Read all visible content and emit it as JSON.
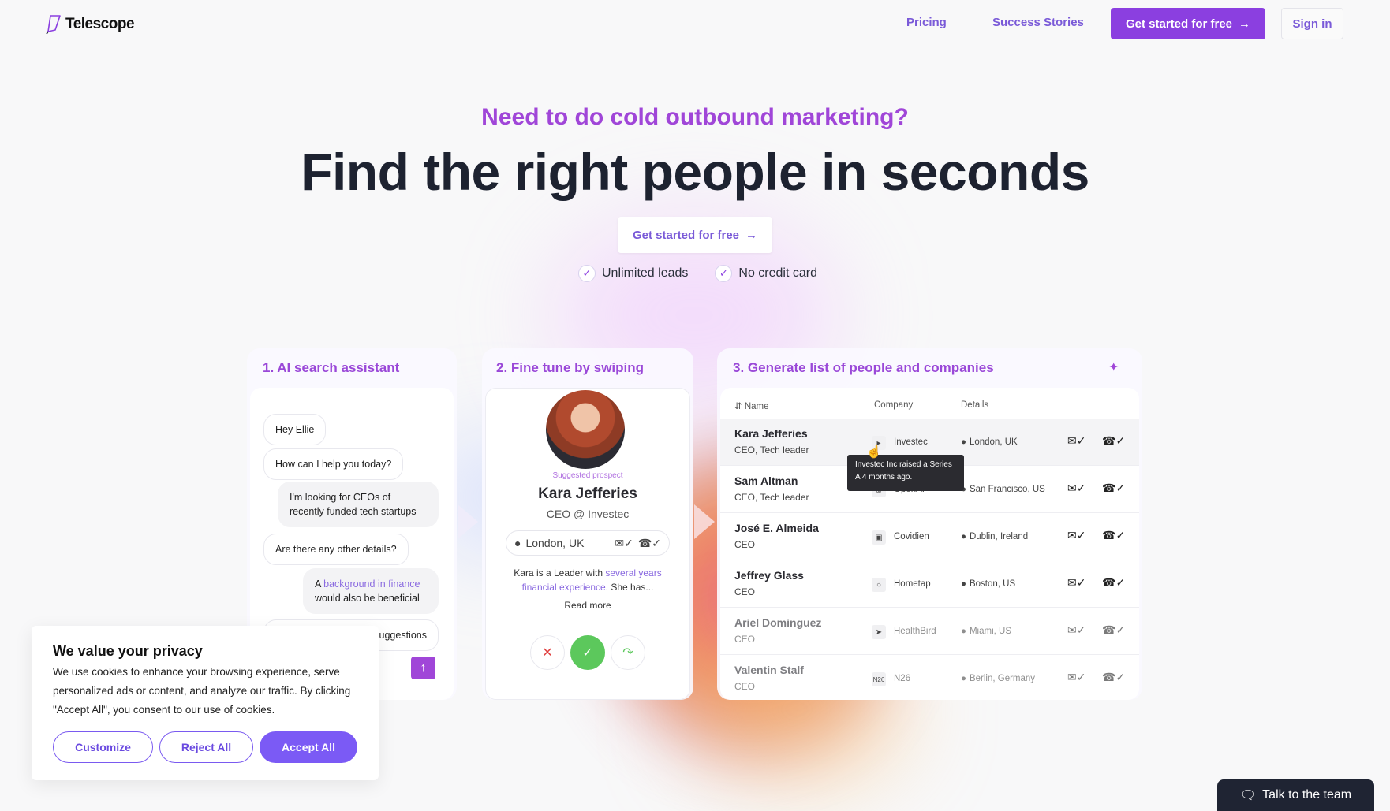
{
  "nav": {
    "logo": "Telescope",
    "links": [
      "Pricing",
      "Success Stories"
    ],
    "cta": "Get started for free",
    "signin": "Sign in"
  },
  "hero": {
    "eyebrow": "Need to do cold outbound marketing?",
    "headline": "Find the right people in seconds",
    "cta": "Get started for free",
    "checks": [
      "Unlimited leads",
      "No credit card"
    ]
  },
  "panels": {
    "assistant": {
      "title": "1. AI search assistant",
      "messages": [
        {
          "from": "bot",
          "text": "Hey Ellie"
        },
        {
          "from": "bot",
          "text": "How can I help you today?"
        },
        {
          "from": "user",
          "text": "I'm looking for CEOs of recently funded tech startups"
        },
        {
          "from": "bot",
          "text": "Are there any other details?"
        },
        {
          "from": "user",
          "pre": "A ",
          "highlight": "background in finance",
          "post": " would also be beneficial"
        },
        {
          "from": "bot",
          "text": "suggestions"
        }
      ]
    },
    "swipe": {
      "title": "2. Fine tune by swiping",
      "suggested": "Suggested prospect",
      "name": "Kara Jefferies",
      "role": "CEO @ Investec",
      "location": "London, UK",
      "desc_pre": "Kara is a Leader with ",
      "desc_hl": "several years financial experience",
      "desc_post": ". She has...",
      "read_more": "Read more"
    },
    "list": {
      "title": "3. Generate list of people and companies",
      "headers": [
        "Name",
        "Company",
        "Details"
      ],
      "tooltip": "Investec Inc raised a Series A 4 months ago.",
      "rows": [
        {
          "name": "Kara Jefferies",
          "title": "CEO, Tech leader",
          "company": "Investec",
          "icon": "investec-logo-icon",
          "location": "London, UK"
        },
        {
          "name": "Sam Altman",
          "title": "CEO, Tech leader",
          "company": "OpenAI",
          "icon": "openai-logo-icon",
          "location": "San Francisco, US"
        },
        {
          "name": "José E. Almeida",
          "title": "CEO",
          "company": "Covidien",
          "icon": "covidien-logo-icon",
          "location": "Dublin, Ireland"
        },
        {
          "name": "Jeffrey Glass",
          "title": "CEO",
          "company": "Hometap",
          "icon": "hometap-logo-icon",
          "location": "Boston, US"
        },
        {
          "name": "Ariel Dominguez",
          "title": "CEO",
          "company": "HealthBird",
          "icon": "healthbird-logo-icon",
          "location": "Miami, US"
        },
        {
          "name": "Valentin Stalf",
          "title": "CEO",
          "company": "N26",
          "icon": "n26-logo-icon",
          "location": "Berlin, Germany"
        }
      ]
    }
  },
  "cookie": {
    "title": "We value your privacy",
    "text": "We use cookies to enhance your browsing experience, serve personalized ads or content, and analyze our traffic. By clicking \"Accept All\", you consent to our use of cookies.",
    "customize": "Customize",
    "reject": "Reject All",
    "accept": "Accept All"
  },
  "chat_widget": {
    "label": "Talk to the team"
  },
  "colors": {
    "accent": "#8b3fe0",
    "link": "#7a5ad8",
    "cookie_accent": "#7b5af5",
    "dark": "#1f2433"
  }
}
